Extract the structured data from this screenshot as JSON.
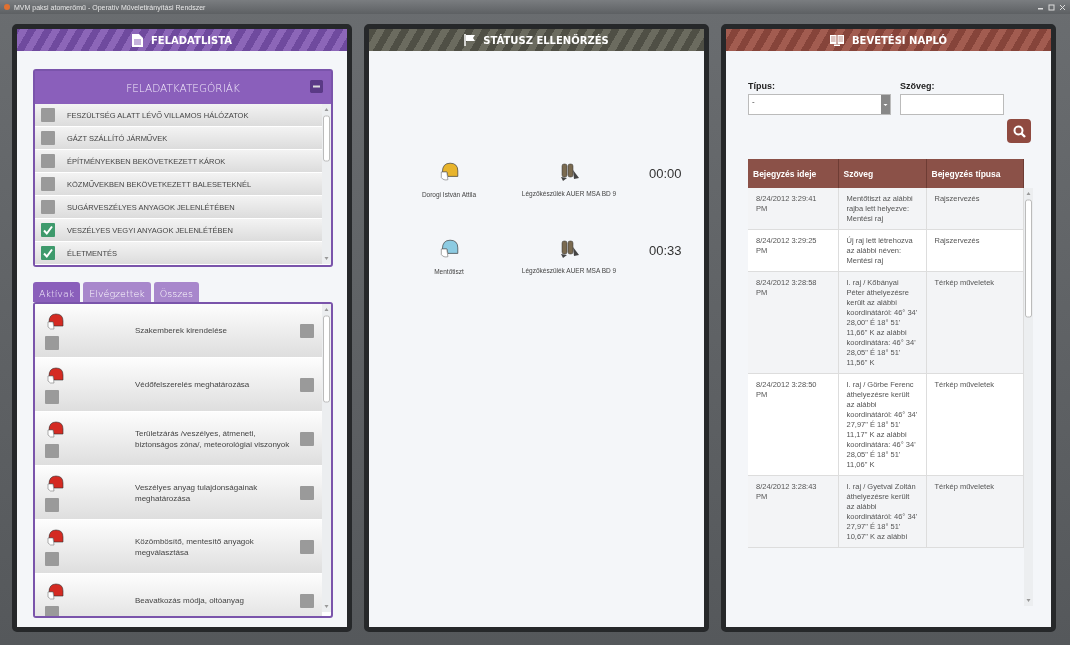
{
  "window": {
    "title": "MVM paksi atomerőmű - Operatív Műveletirányítási Rendszer"
  },
  "task_panel": {
    "title": "FELADATLISTA",
    "categories": {
      "title": "FELADATKATEGÓRIÁK",
      "expanded": true,
      "items": [
        {
          "label": "FESZÜLTSÉG ALATT LÉVŐ VILLAMOS HÁLÓZATOK",
          "checked": false
        },
        {
          "label": "GÁZT SZÁLLÍTÓ JÁRMŰVEK",
          "checked": false
        },
        {
          "label": "ÉPÍTMÉNYEKBEN BEKÖVETKEZETT KÁROK",
          "checked": false
        },
        {
          "label": "KÖZMŰVEKBEN BEKÖVETKEZETT BALESETEKNÉL",
          "checked": false
        },
        {
          "label": "SUGÁRVESZÉLYES ANYAGOK JELENLÉTÉBEN",
          "checked": false
        },
        {
          "label": "VESZÉLYES VEGYI ANYAGOK JELENLÉTÉBEN",
          "checked": true
        },
        {
          "label": "ÉLETMENTÉS",
          "checked": true
        }
      ]
    },
    "tabs": [
      {
        "label": "Aktívak",
        "selected": true
      },
      {
        "label": "Elvégzettek",
        "selected": false
      },
      {
        "label": "Összes",
        "selected": false
      }
    ],
    "tasks": [
      {
        "label": "Szakemberek kirendelése",
        "started": false,
        "checked": false
      },
      {
        "label": "Védőfelszerelés meghatározása",
        "started": false,
        "checked": false
      },
      {
        "label": "Területzárás /veszélyes, átmeneti, biztonságos zóna/, meteorológiai viszonyok",
        "started": false,
        "checked": false
      },
      {
        "label": "Veszélyes anyag tulajdonságainak meghatározása",
        "started": false,
        "checked": false
      },
      {
        "label": "Közömbösítő, mentesítő anyagok megválasztása",
        "started": false,
        "checked": false
      },
      {
        "label": "Beavatkozás módja, oltóanyag",
        "started": false,
        "checked": false
      }
    ]
  },
  "status_panel": {
    "title": "STÁTUSZ ELLENŐRZÉS",
    "rows": [
      {
        "name": "Dorogi István Attila",
        "color": "#e8b42c",
        "device": "Légzőkészülék AUER MSA BD 9",
        "time": "00:00"
      },
      {
        "name": "Mentőtiszt",
        "color": "#8ccbe2",
        "device": "Légzőkészülék AUER MSA BD 9",
        "time": "00:33"
      }
    ]
  },
  "log_panel": {
    "title": "BEVETÉSI NAPLÓ",
    "type_label": "Típus:",
    "type_value": "-",
    "text_label": "Szöveg:",
    "columns": [
      "Bejegyzés ideje",
      "Szöveg",
      "Bejegyzés típusa"
    ],
    "rows": [
      {
        "time": "8/24/2012 3:29:41 PM",
        "text": "Mentőtiszt az alábbi rajba lett helyezve: Mentési raj",
        "type": "Rajszervezés"
      },
      {
        "time": "8/24/2012 3:29:25 PM",
        "text": "Új raj lett létrehozva az alábbi néven: Mentési raj",
        "type": "Rajszervezés"
      },
      {
        "time": "8/24/2012 3:28:58 PM",
        "text": "I. raj / Kőbányai Péter áthelyezésre került az alábbi koordinátáról: 46° 34' 28,00\" É   18° 51' 11,66\" K az alábbi koordinátára: 46° 34' 28,05\" É   18° 51' 11,56\" K",
        "type": "Térkép műveletek"
      },
      {
        "time": "8/24/2012 3:28:50 PM",
        "text": "I. raj / Görbe Ferenc áthelyezésre került az alábbi koordinátáról: 46° 34' 27,97\" É   18° 51' 11,17\" K az alábbi koordinátára: 46° 34' 28,05\" É   18° 51' 11,06\" K",
        "type": "Térkép műveletek"
      },
      {
        "time": "8/24/2012 3:28:43 PM",
        "text": "I. raj / Gyetvai Zoltán áthelyezésre került az alábbi koordinátáról: 46° 34' 27,97\" É   18° 51' 10,67\" K az alábbi",
        "type": "Térkép műveletek"
      }
    ]
  }
}
